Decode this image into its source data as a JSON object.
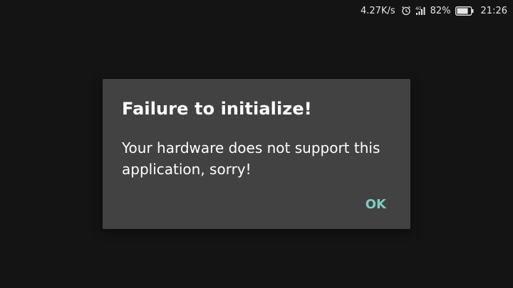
{
  "status_bar": {
    "net_speed": "4.27K/s",
    "alarm_icon": "alarm-clock-icon",
    "signal_icon": "signal-4g-icon",
    "battery_percent": "82%",
    "battery_level": 0.82,
    "time": "21:26"
  },
  "dialog": {
    "title": "Failure to initialize!",
    "message": "Your hardware does not support this application, sorry!",
    "ok_label": "OK"
  },
  "colors": {
    "background": "#141414",
    "dialog_background": "#424242",
    "accent": "#80cbc4",
    "text": "#ffffff"
  }
}
